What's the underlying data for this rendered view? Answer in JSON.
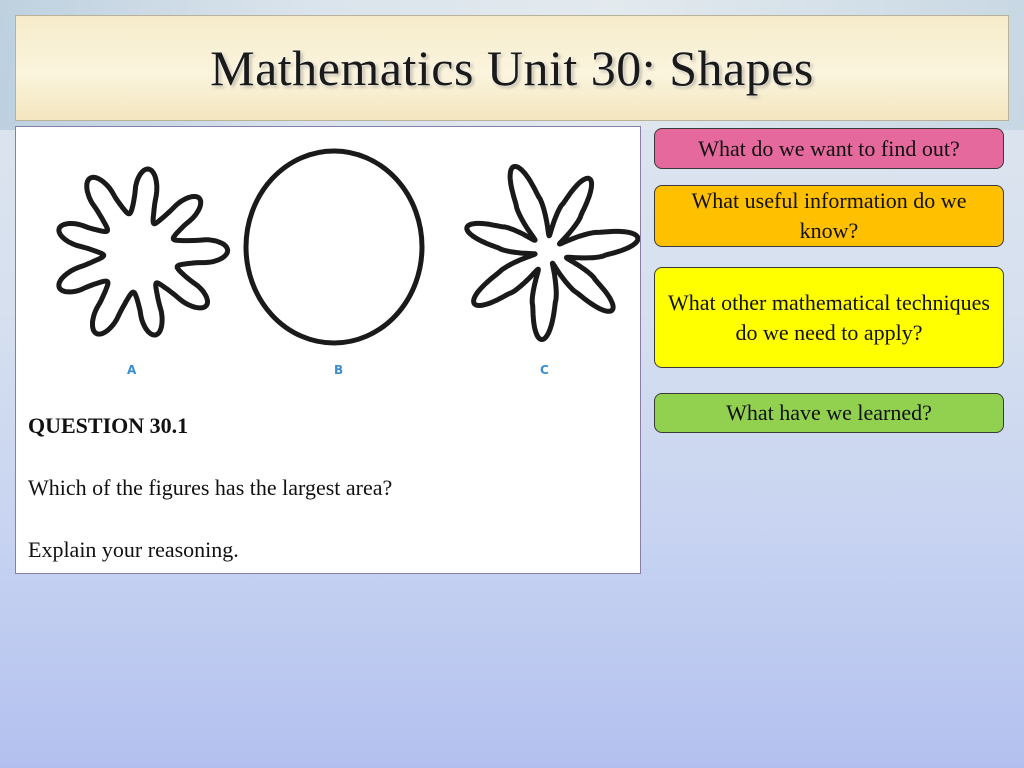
{
  "title": "Mathematics Unit 30: Shapes",
  "figures": {
    "labels": [
      "A",
      "B",
      "C"
    ],
    "label_color": "#3a8ed0"
  },
  "question": {
    "heading": "QUESTION 30.1",
    "text": "Which of the figures has the largest area?",
    "instruction": "Explain your reasoning."
  },
  "prompts": [
    {
      "text": "What do we want to find out?",
      "color": "#e5699c"
    },
    {
      "text": "What useful information do we know?",
      "color": "#ffc000"
    },
    {
      "text": "What other mathematical techniques do we need to apply?",
      "color": "#ffff00"
    },
    {
      "text": "What have we learned?",
      "color": "#92d050"
    }
  ]
}
